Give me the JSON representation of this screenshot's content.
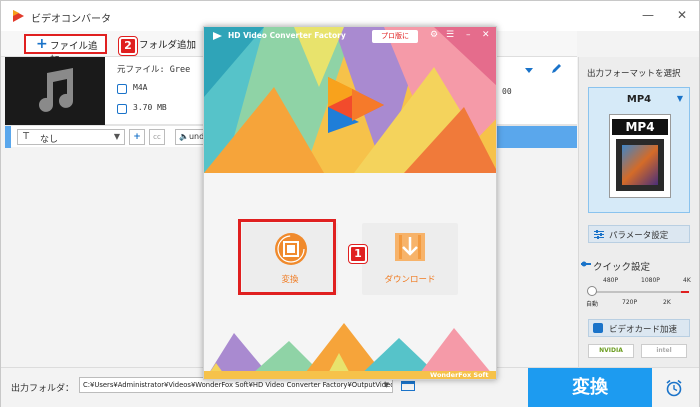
{
  "app": {
    "title": "ビデオコンバータ",
    "minimize_glyph": "—",
    "close_glyph": "✕"
  },
  "toolbar": {
    "add_file_label": "ファイル追加",
    "add_folder_label": "フォルダ追加",
    "step2_badge": "2"
  },
  "file_item": {
    "source_label": "元ファイル: Gree",
    "format": "M4A",
    "size": "3.70 MB",
    "right_fragment": "00"
  },
  "edit_bar": {
    "subtitle_value": "なし",
    "audio_value": "und"
  },
  "right_panel": {
    "title": "出力フォーマットを選択",
    "format_name": "MP4",
    "format_icon_text": "MP4",
    "param_label": "パラメータ設定",
    "quick_label": "クイック設定",
    "quality_top": [
      "480P",
      "1080P",
      "4K"
    ],
    "quality_bottom": [
      "自動",
      "720P",
      "2K"
    ],
    "gpu_label": "ビデオカード加速",
    "vendors": [
      "NVIDIA",
      "intel"
    ]
  },
  "bottom": {
    "output_label": "出力フォルダ：",
    "output_path": "C:¥Users¥Administrator¥Videos¥WonderFox Soft¥HD Video Converter Factory¥OutputVideo¥",
    "convert_label": "変換"
  },
  "dialog": {
    "title": "HD Video Converter Factory",
    "pro_label": "プロ版に",
    "convert_tile_label": "変換",
    "download_tile_label": "ダウンロード",
    "step1_badge": "1",
    "brand": "WonderFox Soft"
  },
  "colors": {
    "accent": "#1d9bf0",
    "highlight": "#e02020",
    "tile_orange": "#f08a2c"
  },
  "icons": [
    "app-logo-icon",
    "plus-icon",
    "music-note-icon",
    "audio-format-icon",
    "file-size-icon",
    "edit-icon",
    "text-icon",
    "add-icon",
    "cc-icon",
    "speaker-icon",
    "film-icon",
    "download-arrow-icon",
    "folder-icon",
    "alarm-clock-icon",
    "settings-icon",
    "menu-icon",
    "close-icon",
    "minimize-icon"
  ]
}
